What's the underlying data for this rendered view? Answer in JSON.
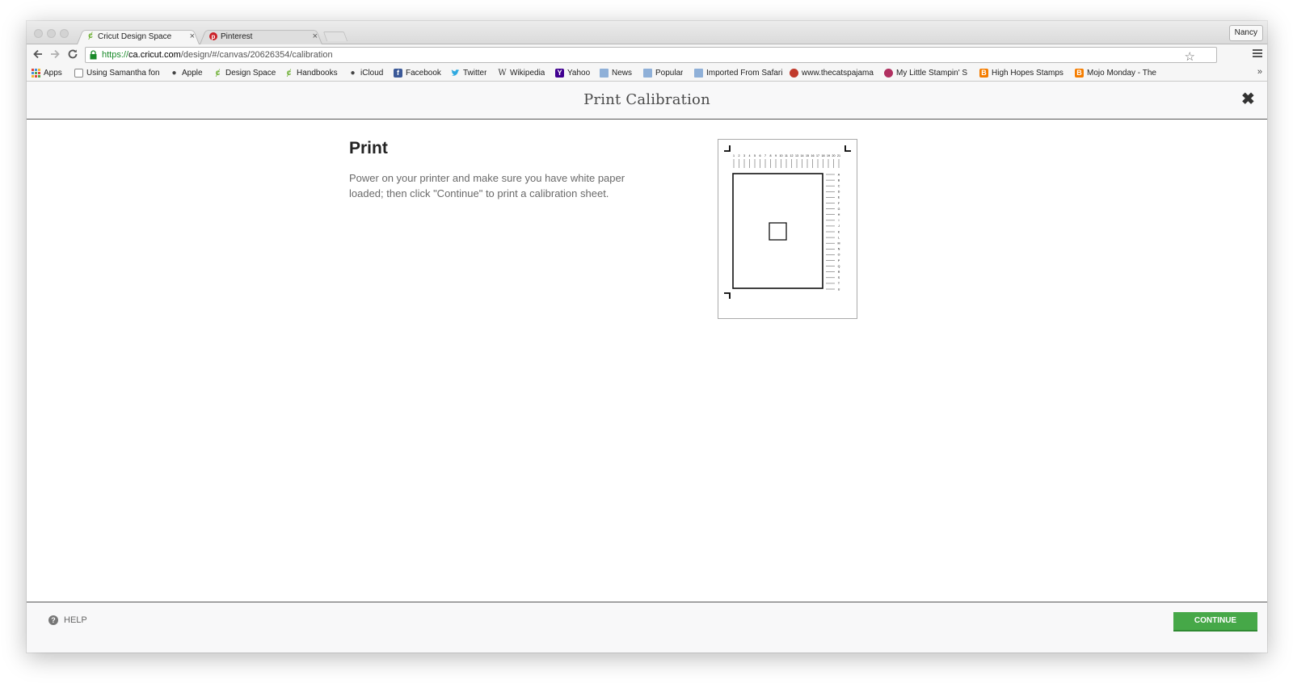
{
  "browser": {
    "tabs": [
      {
        "title": "Cricut Design Space",
        "favicon": "cricut-icon",
        "active": true
      },
      {
        "title": "Pinterest",
        "favicon": "pinterest-icon",
        "active": false
      }
    ],
    "tab_close_glyph": "×",
    "profile_name": "Nancy",
    "url": {
      "scheme": "https://",
      "host": "ca.cricut.com",
      "path": "/design/#/canvas/20626354/calibration"
    },
    "bookmarks": [
      {
        "label": "Apps",
        "icon": "apps-grid-icon"
      },
      {
        "label": "Using Samantha fon",
        "icon": "page-icon"
      },
      {
        "label": "Apple",
        "icon": "apple-icon"
      },
      {
        "label": "Design Space",
        "icon": "cricut-icon"
      },
      {
        "label": "Handbooks",
        "icon": "cricut-icon"
      },
      {
        "label": "iCloud",
        "icon": "apple-icon"
      },
      {
        "label": "Facebook",
        "icon": "facebook-icon"
      },
      {
        "label": "Twitter",
        "icon": "twitter-icon"
      },
      {
        "label": "Wikipedia",
        "icon": "wikipedia-icon"
      },
      {
        "label": "Yahoo",
        "icon": "yahoo-icon"
      },
      {
        "label": "News",
        "icon": "folder-icon"
      },
      {
        "label": "Popular",
        "icon": "folder-icon"
      },
      {
        "label": "Imported From Safari",
        "icon": "folder-icon"
      },
      {
        "label": "www.thecatspajama",
        "icon": "cat-icon"
      },
      {
        "label": "My Little Stampin' S",
        "icon": "stamp-icon"
      },
      {
        "label": "High Hopes Stamps",
        "icon": "blogger-icon"
      },
      {
        "label": "Mojo Monday - The",
        "icon": "blogger-icon"
      }
    ],
    "bookmarks_overflow": "»"
  },
  "dialog": {
    "title": "Print Calibration",
    "close_glyph": "✖",
    "step_title": "Print",
    "step_text": "Power on your printer and make sure you have white paper loaded; then click \"Continue\" to print a calibration sheet.",
    "preview": {
      "column_numbers": [
        "1",
        "2",
        "3",
        "4",
        "5",
        "6",
        "7",
        "8",
        "9",
        "10",
        "11",
        "12",
        "13",
        "14",
        "15",
        "16",
        "17",
        "18",
        "19",
        "20",
        "21"
      ],
      "row_letters": [
        "A",
        "B",
        "C",
        "D",
        "E",
        "F",
        "G",
        "H",
        "I",
        "J",
        "K",
        "L",
        "M",
        "N",
        "O",
        "P",
        "Q",
        "R",
        "S",
        "T",
        "U"
      ]
    },
    "help_label": "HELP",
    "continue_label": "CONTINUE",
    "accent_color": "#46a848"
  }
}
